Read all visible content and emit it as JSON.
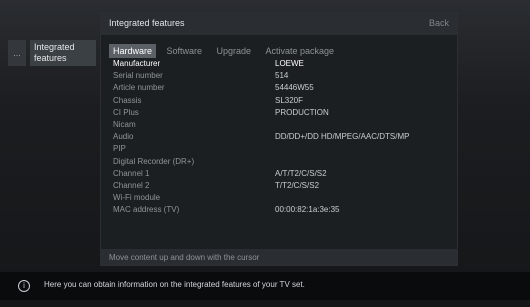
{
  "left_menu": {
    "nub": "...",
    "item": "Integrated features"
  },
  "panel": {
    "title": "Integrated features",
    "back": "Back",
    "tabs": [
      "Hardware",
      "Software",
      "Upgrade",
      "Activate package"
    ],
    "rows": [
      {
        "k": "Manufacturer",
        "v": "LOEWE"
      },
      {
        "k": "Serial number",
        "v": "514"
      },
      {
        "k": "Article number",
        "v": "54446W55"
      },
      {
        "k": "Chassis",
        "v": "SL320F"
      },
      {
        "k": "CI Plus",
        "v": "PRODUCTION"
      },
      {
        "k": "Nicam",
        "v": ""
      },
      {
        "k": "Audio",
        "v": "DD/DD+/DD HD/MPEG/AAC/DTS/MP"
      },
      {
        "k": "PIP",
        "v": ""
      },
      {
        "k": "Digital Recorder (DR+)",
        "v": ""
      },
      {
        "k": "Channel 1",
        "v": "A/T/T2/C/S/S2"
      },
      {
        "k": "Channel 2",
        "v": "T/T2/C/S/S2"
      },
      {
        "k": "Wi-Fi module",
        "v": ""
      },
      {
        "k": "MAC address (TV)",
        "v": "00:00:82:1a:3e:35"
      }
    ],
    "footer": "Move content up and down with the cursor"
  },
  "info_bar": {
    "icon": "info-icon",
    "text": "Here you can obtain information on the integrated features of your TV set."
  }
}
